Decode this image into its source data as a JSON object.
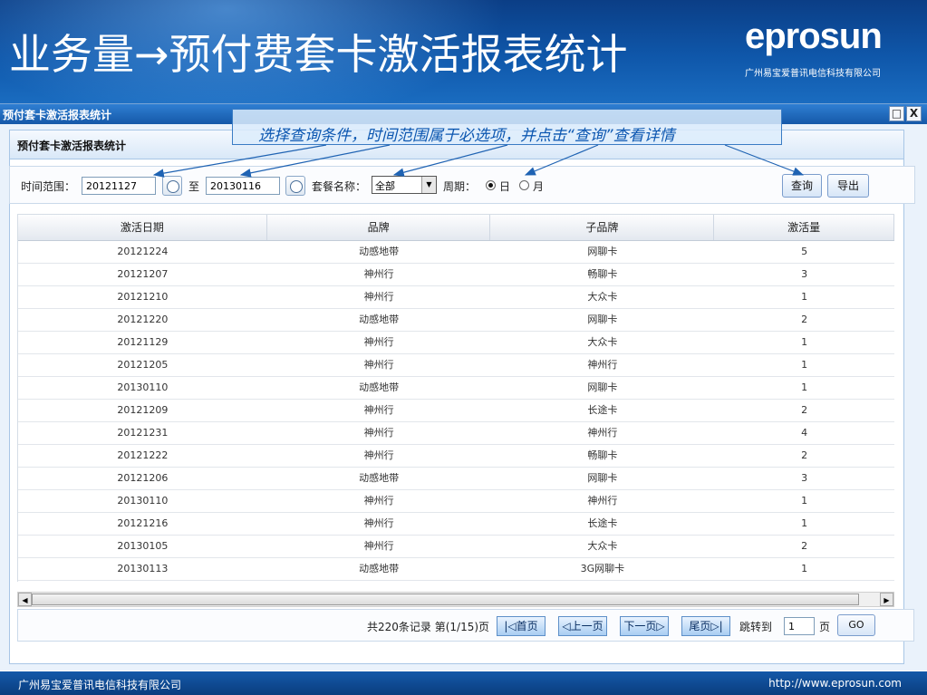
{
  "slide": {
    "title": "业务量→预付费套卡激活报表统计",
    "logo": "eprosun",
    "logo_sub": "广州易宝爱普讯电信科技有限公司",
    "footer_left": "广州易宝爱普讯电信科技有限公司",
    "footer_right": "http://www.eprosun.com"
  },
  "window": {
    "title": "预付套卡激活报表统计",
    "panel_title": "预付套卡激活报表统计",
    "max_glyph": "□",
    "close_glyph": "X"
  },
  "callout": "选择查询条件，时间范围属于必选项，并点击“查询”查看详情",
  "filters": {
    "time_label": "时间范围：",
    "start_date": "20121127",
    "to_label": "至",
    "end_date": "20130116",
    "package_label": "套餐名称：",
    "package_value": "全部",
    "cycle_label": "周期：",
    "day_label": "日",
    "month_label": "月",
    "query_button": "查询",
    "export_button": "导出"
  },
  "table": {
    "headers": [
      "激活日期",
      "品牌",
      "子品牌",
      "激活量"
    ],
    "rows": [
      [
        "20121224",
        "动感地带",
        "网聊卡",
        "5"
      ],
      [
        "20121207",
        "神州行",
        "畅聊卡",
        "3"
      ],
      [
        "20121210",
        "神州行",
        "大众卡",
        "1"
      ],
      [
        "20121220",
        "动感地带",
        "网聊卡",
        "2"
      ],
      [
        "20121129",
        "神州行",
        "大众卡",
        "1"
      ],
      [
        "20121205",
        "神州行",
        "神州行",
        "1"
      ],
      [
        "20130110",
        "动感地带",
        "网聊卡",
        "1"
      ],
      [
        "20121209",
        "神州行",
        "长途卡",
        "2"
      ],
      [
        "20121231",
        "神州行",
        "神州行",
        "4"
      ],
      [
        "20121222",
        "神州行",
        "畅聊卡",
        "2"
      ],
      [
        "20121206",
        "动感地带",
        "网聊卡",
        "3"
      ],
      [
        "20130110",
        "神州行",
        "神州行",
        "1"
      ],
      [
        "20121216",
        "神州行",
        "长途卡",
        "1"
      ],
      [
        "20130105",
        "神州行",
        "大众卡",
        "2"
      ],
      [
        "20130113",
        "动感地带",
        "3G网聊卡",
        "1"
      ]
    ]
  },
  "pager": {
    "summary": "共220条记录 第(1/15)页",
    "first": "|◁首页",
    "prev": "◁上一页",
    "next": "下一页▷",
    "last": "尾页▷|",
    "jump_label": "跳转到",
    "page_value": "1",
    "page_unit": "页",
    "go": "GO"
  }
}
